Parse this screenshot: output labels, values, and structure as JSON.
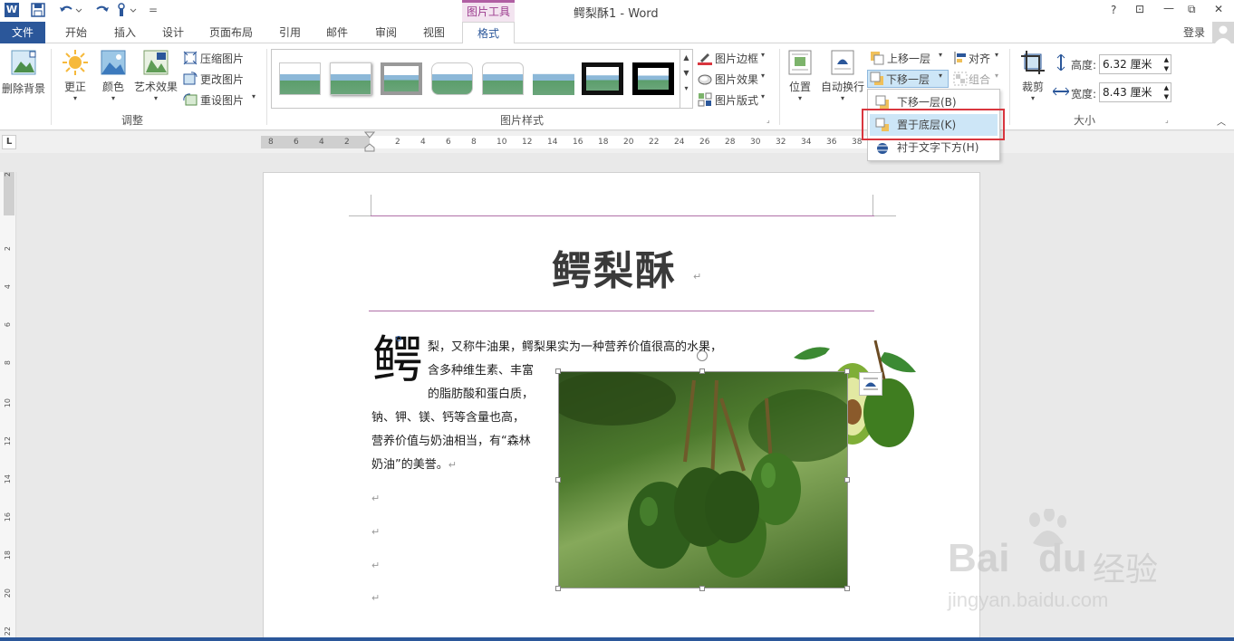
{
  "window": {
    "title": "鳄梨酥1 - Word",
    "context_tool": "图片工具",
    "qat_separator": "=",
    "controls": {
      "help": "?",
      "restore_ribbon": "⊡",
      "minimize": "—",
      "maximize": "⧉",
      "close": "✕"
    }
  },
  "tabs": [
    "开始",
    "插入",
    "设计",
    "页面布局",
    "引用",
    "邮件",
    "审阅",
    "视图"
  ],
  "file_tab": "文件",
  "active_tab": "格式",
  "login": "登录",
  "ribbon": {
    "remove_bg": "删除背景",
    "corrections": "更正",
    "color": "颜色",
    "artistic": "艺术效果",
    "compress": "压缩图片",
    "change": "更改图片",
    "reset": "重设图片",
    "adjust_group": "调整",
    "styles_group": "图片样式",
    "border": "图片边框",
    "effects": "图片效果",
    "layout": "图片版式",
    "position": "位置",
    "wrap": "自动换行",
    "bring_forward": "上移一层",
    "send_backward": "下移一层",
    "align": "对齐",
    "group": "组合",
    "crop": "裁剪",
    "height_label": "高度:",
    "height_value": "6.32 厘米",
    "width_label": "宽度:",
    "width_value": "8.43 厘米",
    "size_group": "大小"
  },
  "dropdown": {
    "items": [
      "下移一层(B)",
      "置于底层(K)",
      "衬于文字下方(H)"
    ],
    "highlighted": "置于底层(K)"
  },
  "ruler": {
    "corner": "L",
    "hticks": [
      "8",
      "6",
      "4",
      "2",
      "2",
      "4",
      "6",
      "8",
      "10",
      "12",
      "14",
      "16",
      "18",
      "20",
      "22",
      "24",
      "26",
      "28",
      "30",
      "32",
      "34",
      "36",
      "38"
    ],
    "vticks": [
      "2",
      "2",
      "4",
      "6",
      "8",
      "10",
      "12",
      "14",
      "16",
      "18",
      "20",
      "22"
    ]
  },
  "document": {
    "heading": "鳄梨酥",
    "dropcap": "鳄",
    "lines": [
      "梨，又称牛油果，鳄梨果实为一种营养价值很高的水果，",
      "含多种维生素、丰富",
      "的脂肪酸和蛋白质，",
      "钠、钾、镁、钙等含量也高，",
      "营养价值与奶油相当，有“森林",
      "奶油”的美誉。"
    ],
    "return_mark": "↵"
  },
  "watermark": {
    "brand": "Bai",
    "brand2": "du",
    "cn": "经验",
    "url": "jingyan.baidu.com"
  },
  "colors": {
    "accent": "#2b579a",
    "context": "#b05fa3",
    "highlight_box": "#d9363e"
  }
}
